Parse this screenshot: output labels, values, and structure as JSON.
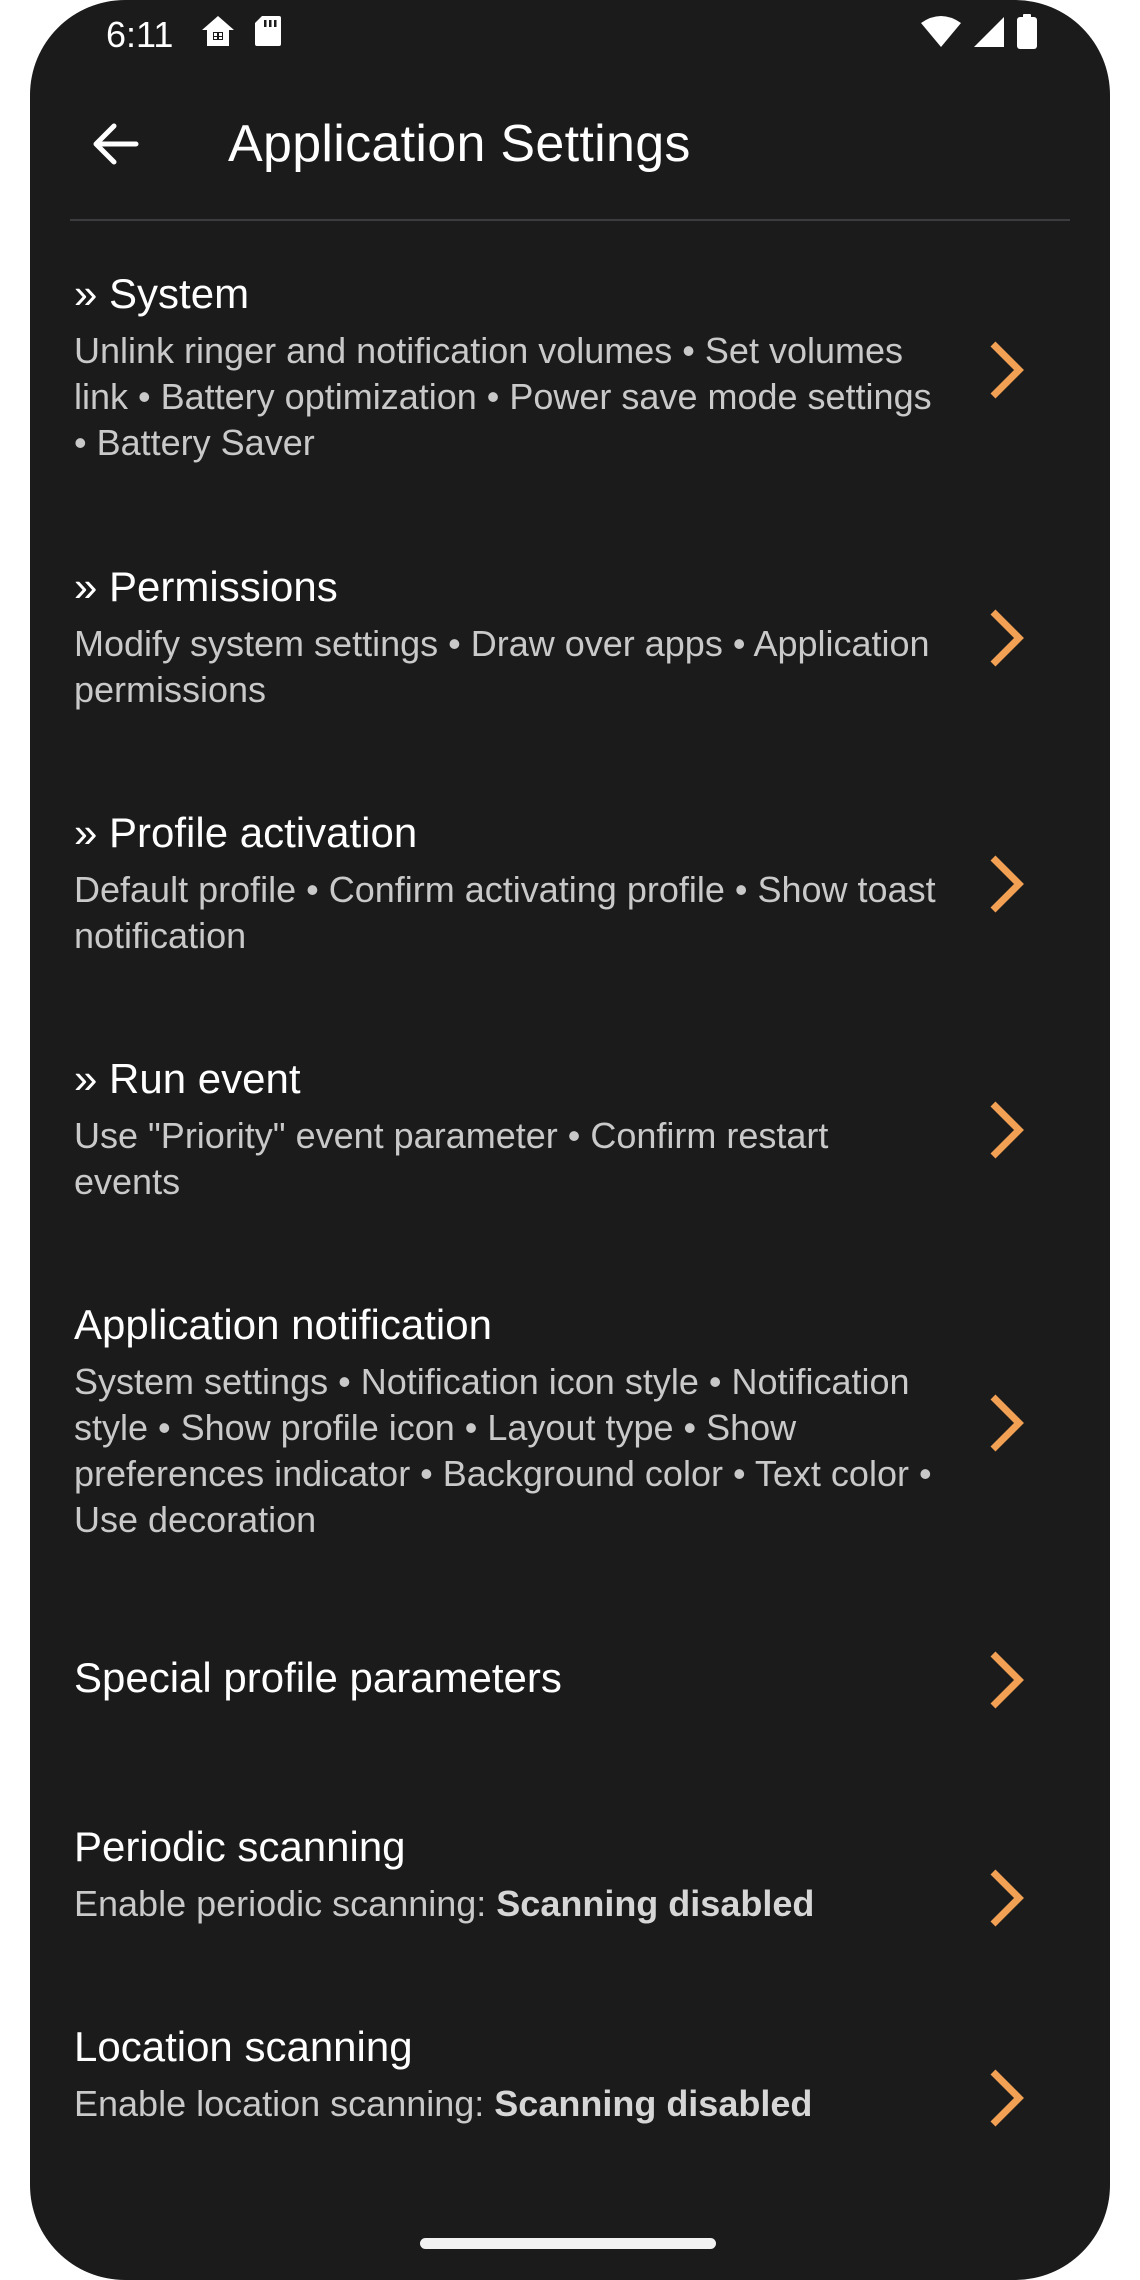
{
  "status_bar": {
    "time": "6:11",
    "left_icons": [
      "home-icon",
      "sd-card-icon"
    ],
    "right_icons": [
      "wifi-icon",
      "cell-signal-icon",
      "battery-icon"
    ]
  },
  "app_bar": {
    "back_icon": "arrow-back-icon",
    "title": "Application Settings"
  },
  "accent_color": "#f2a154",
  "items": [
    {
      "title": "» System",
      "summary": "Unlink ringer and notification volumes • Set volumes link • Battery optimization • Power save mode settings • Battery Saver"
    },
    {
      "title": "» Permissions",
      "summary": "Modify system settings • Draw over apps • Application permissions"
    },
    {
      "title": "» Profile activation",
      "summary": "Default profile • Confirm activating profile • Show toast notification"
    },
    {
      "title": "» Run event",
      "summary": "Use \"Priority\" event parameter • Confirm restart events"
    },
    {
      "title": "Application notification",
      "summary": "System settings • Notification icon style • Notification style • Show profile icon • Layout type • Show preferences indicator • Background color • Text color • Use decoration"
    },
    {
      "title": "Special profile parameters",
      "summary": ""
    },
    {
      "title": "Periodic scanning",
      "summary_prefix": "Enable periodic scanning: ",
      "summary_value": "Scanning disabled"
    },
    {
      "title": "Location scanning",
      "summary_prefix": "Enable location scanning: ",
      "summary_value": "Scanning disabled"
    }
  ]
}
